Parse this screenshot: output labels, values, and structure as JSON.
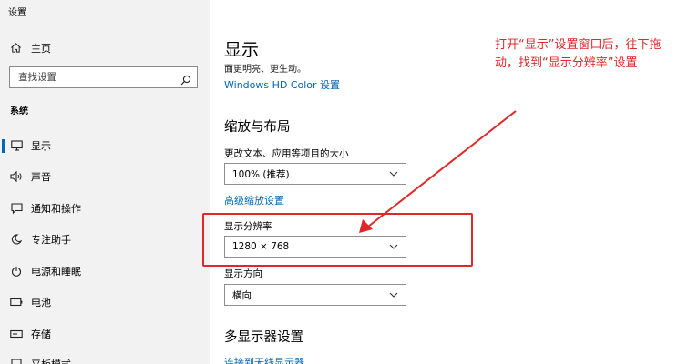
{
  "window": {
    "title": "设置"
  },
  "sidebar": {
    "home_label": "主页",
    "search_placeholder": "查找设置",
    "section_label": "系统",
    "items": [
      {
        "label": "显示",
        "icon": "monitor-icon",
        "active": true
      },
      {
        "label": "声音",
        "icon": "speaker-icon"
      },
      {
        "label": "通知和操作",
        "icon": "notification-icon"
      },
      {
        "label": "专注助手",
        "icon": "moon-icon"
      },
      {
        "label": "电源和睡眠",
        "icon": "power-icon"
      },
      {
        "label": "电池",
        "icon": "battery-icon"
      },
      {
        "label": "存储",
        "icon": "storage-icon"
      },
      {
        "label": "平板模式",
        "icon": "tablet-icon"
      }
    ]
  },
  "main": {
    "title": "显示",
    "subtitle": "面更明亮、更生动。",
    "hd_color_link": "Windows HD Color 设置",
    "scale_heading": "缩放与布局",
    "scale_label": "更改文本、应用等项目的大小",
    "scale_value": "100% (推荐)",
    "advanced_scaling_link": "高级缩放设置",
    "resolution_label": "显示分辨率",
    "resolution_value": "1280 × 768",
    "orientation_label": "显示方向",
    "orientation_value": "横向",
    "multi_display_heading": "多显示器设置",
    "wireless_link": "连接到无线显示器"
  },
  "annotation": {
    "text": "打开“显示”设置窗口后，往下拖动，找到“显示分辨率”设置",
    "color": "#e0282a"
  },
  "colors": {
    "accent": "#0067b8",
    "sidebar_bg": "#f2f2f2"
  }
}
